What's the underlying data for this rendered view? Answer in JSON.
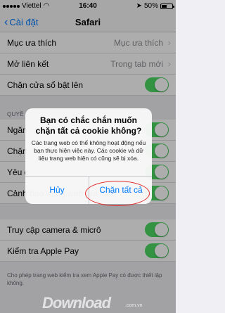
{
  "status_bar": {
    "carrier": "Viettel",
    "time": "16:40",
    "battery": "50%",
    "battery_level": 0.5
  },
  "nav": {
    "back_label": "Cài đặt",
    "title": "Safari"
  },
  "rows": [
    {
      "label": "Mục ưa thích",
      "value": "Mục ưa thích"
    },
    {
      "label": "Mở liên kết",
      "value": "Trong tab mới"
    },
    {
      "label": "Chặn cửa sổ bật lên"
    }
  ],
  "section_header": "QUYỀ",
  "privacy_rows": [
    {
      "label": "Ngăn"
    },
    {
      "label": "Chặn"
    },
    {
      "label": "Yêu c"
    },
    {
      "label": "Cảnh báo trang web lừa đảo"
    },
    {
      "label": "Truy cập camera & micrô"
    },
    {
      "label": "Kiểm tra Apple Pay"
    }
  ],
  "footer": "Cho phép trang web kiểm tra xem Apple Pay có được thiết lập không.",
  "alert": {
    "title": "Bạn có chắc chắn muốn chặn tất cả cookie không?",
    "message": "Các trang web có thể không hoạt động nếu bạn thực hiện việc này. Các cookie và dữ liệu trang web hiện có cũng sẽ bị xóa.",
    "cancel_label": "Hủy",
    "confirm_label": "Chặn tất cả"
  },
  "watermark": {
    "brand": "Download",
    "domain": ".com.vn"
  },
  "colors": {
    "accent": "#007aff",
    "toggle_on": "#4cd964",
    "highlight": "#e12a2a"
  }
}
